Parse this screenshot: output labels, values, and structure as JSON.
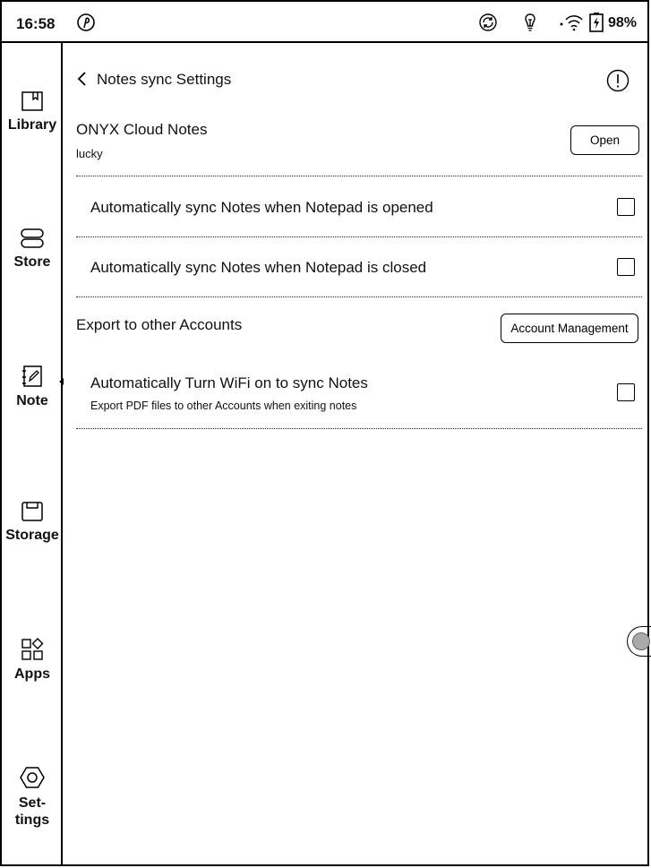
{
  "status_bar": {
    "time": "16:58",
    "battery": "98%",
    "icons": [
      "pinterest-like-p-icon",
      "sync-icon",
      "lightbulb-icon",
      "wifi-icon",
      "battery-icon"
    ]
  },
  "sidebar": {
    "items": [
      {
        "label": "Library",
        "icon": "book-icon"
      },
      {
        "label": "Store",
        "icon": "store-icon"
      },
      {
        "label": "Note",
        "icon": "note-pen-icon",
        "active": true
      },
      {
        "label": "Storage",
        "icon": "storage-icon"
      },
      {
        "label": "Apps",
        "icon": "apps-grid-icon"
      },
      {
        "label": "Set-\ntings",
        "icon": "hexagon-gear-icon"
      }
    ]
  },
  "header": {
    "title": "Notes sync Settings"
  },
  "cloud": {
    "title": "ONYX Cloud Notes",
    "account": "lucky",
    "open_label": "Open"
  },
  "options": {
    "sync_on_open": "Automatically sync Notes when Notepad is opened",
    "sync_on_close": "Automatically sync Notes when Notepad is closed"
  },
  "export": {
    "title": "Export to other Accounts",
    "manage_label": "Account Management",
    "wifi_label": "Automatically Turn WiFi on to sync Notes",
    "wifi_sub": "Export PDF files to other Accounts when exiting notes"
  }
}
